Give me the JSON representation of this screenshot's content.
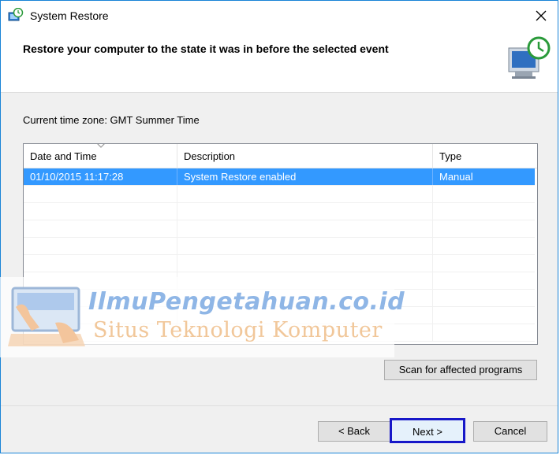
{
  "window": {
    "title": "System Restore",
    "close_icon": "close-icon",
    "app_icon": "system-restore-icon"
  },
  "header": {
    "title": "Restore your computer to the state it was in before the selected event",
    "icon": "restore-monitor-icon"
  },
  "timezone_label": "Current time zone: GMT Summer Time",
  "list": {
    "columns": [
      "Date and Time",
      "Description",
      "Type"
    ],
    "sorted_column": "Date and Time",
    "rows": [
      {
        "date": "01/10/2015 11:17:28",
        "description": "System Restore enabled",
        "type": "Manual",
        "selected": true
      }
    ],
    "empty_rows_visible": 9
  },
  "buttons": {
    "scan": "Scan for affected programs",
    "back": "< Back",
    "next": "Next >",
    "cancel": "Cancel"
  },
  "watermark": {
    "title": "IlmuPengetahuan.co.id",
    "subtitle": "Situs Teknologi Komputer"
  },
  "colors": {
    "selection": "#3399ff",
    "focus_outline": "#1717c8",
    "window_border": "#1883d7"
  }
}
